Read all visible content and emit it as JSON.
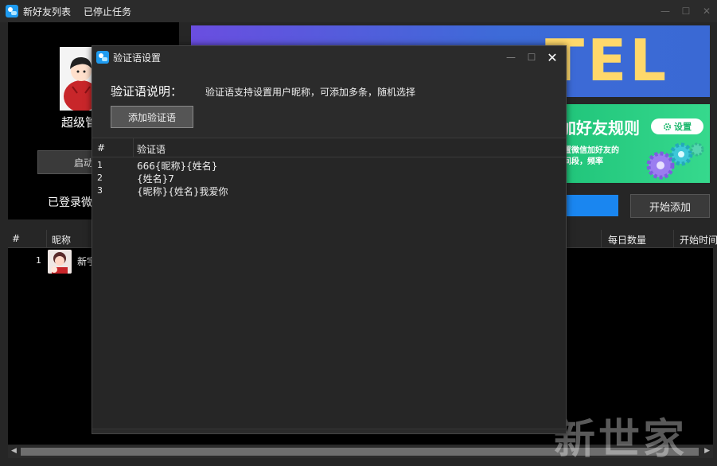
{
  "window": {
    "title": "新好友列表",
    "status": "已停止任务",
    "minimize": "—",
    "maximize": "☐",
    "close": "✕"
  },
  "left_panel": {
    "nickname_partial": "超级管",
    "start_button": "启动",
    "login_status": "已登录微"
  },
  "banner1": {
    "text": "TEL"
  },
  "banner2": {
    "title": "加好友规则",
    "subtitle1": "置微信加好友的",
    "subtitle2": "间段，频率",
    "button": "设置"
  },
  "start_add_button": "开始添加",
  "main_table": {
    "columns": [
      "#",
      "昵称",
      "每日数量",
      "开始时间"
    ],
    "rows": [
      {
        "num": "1",
        "name": "新宇"
      }
    ]
  },
  "watermark": "新世家",
  "dialog": {
    "title": "验证语设置",
    "minimize": "—",
    "maximize": "☐",
    "close": "✕",
    "desc_label": "验证语说明：",
    "desc_text": "验证语支持设置用户昵称，可添加多条，随机选择",
    "add_button": "添加验证语",
    "table": {
      "col_num": "#",
      "col_text": "验证语",
      "rows": [
        {
          "num": "1",
          "text": "666{昵称}{姓名}"
        },
        {
          "num": "2",
          "text": "{姓名}7"
        },
        {
          "num": "3",
          "text": "{昵称}{姓名}我爱你"
        }
      ]
    }
  },
  "colors": {
    "background": "#262626",
    "accent_blue": "#1a86f0",
    "banner_green": "#20c47a",
    "banner_yellow": "#ffd86b"
  }
}
